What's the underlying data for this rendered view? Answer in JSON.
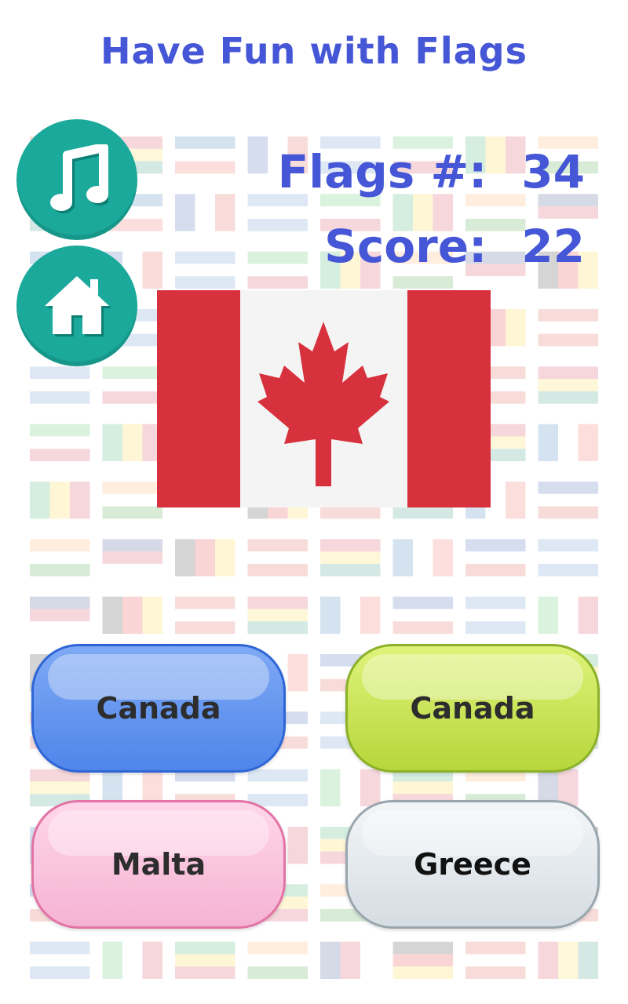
{
  "header": {
    "title": "Have Fun with Flags"
  },
  "controls": {
    "music_icon": "music-note-icon",
    "home_icon": "home-icon"
  },
  "stats": {
    "flags_label": "Flags #:",
    "flags_value": "34",
    "score_label": "Score:",
    "score_value": "22"
  },
  "question": {
    "flag": "Canada"
  },
  "answers": [
    {
      "label": "Canada",
      "color": "#5a8ef0"
    },
    {
      "label": "Canada",
      "color": "#c6e24a"
    },
    {
      "label": "Malta",
      "color": "#f7bfdc"
    },
    {
      "label": "Greece",
      "color": "#e3e9ee"
    }
  ],
  "colors": {
    "accent": "#4556d6",
    "teal": "#1aa99a",
    "flag_red": "#d8313e"
  }
}
